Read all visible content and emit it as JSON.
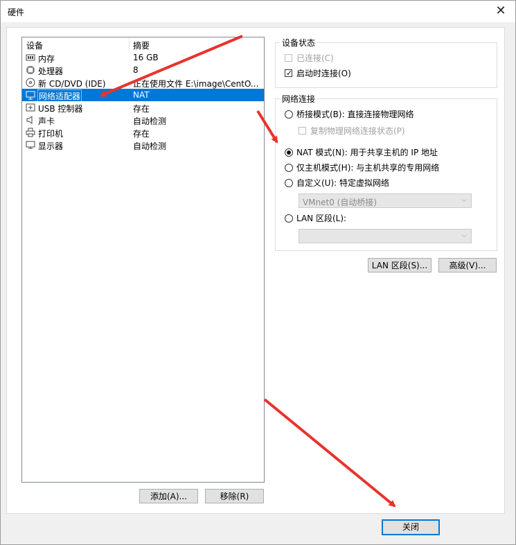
{
  "window": {
    "title": "硬件",
    "close_glyph": "✕"
  },
  "device_list": {
    "columns": [
      "设备",
      "摘要"
    ],
    "rows": [
      {
        "name": "内存",
        "summary": "16 GB",
        "icon": "memory-icon"
      },
      {
        "name": "处理器",
        "summary": "8",
        "icon": "processor-icon"
      },
      {
        "name": "新 CD/DVD (IDE)",
        "summary": "正在使用文件 E:\\image\\CentO...",
        "icon": "cd-dvd-icon"
      },
      {
        "name": "网络适配器",
        "summary": "NAT",
        "icon": "network-adapter-icon",
        "selected": true
      },
      {
        "name": "USB 控制器",
        "summary": "存在",
        "icon": "usb-icon"
      },
      {
        "name": "声卡",
        "summary": "自动检测",
        "icon": "sound-card-icon"
      },
      {
        "name": "打印机",
        "summary": "存在",
        "icon": "printer-icon"
      },
      {
        "name": "显示器",
        "summary": "自动检测",
        "icon": "display-icon"
      }
    ]
  },
  "buttons": {
    "add": "添加(A)...",
    "remove": "移除(R)",
    "lan_segment": "LAN 区段(S)...",
    "advanced": "高级(V)...",
    "close": "关闭"
  },
  "device_status": {
    "title": "设备状态",
    "connected": {
      "label": "已连接(C)",
      "checked": false,
      "enabled": false
    },
    "connect_at_power_on": {
      "label": "启动时连接(O)",
      "checked": true,
      "enabled": true
    }
  },
  "network_connection": {
    "title": "网络连接",
    "bridged": {
      "label": "桥接模式(B): 直接连接物理网络",
      "selected": false
    },
    "replicate": {
      "label": "复制物理网络连接状态(P)",
      "checked": false,
      "enabled": false
    },
    "nat": {
      "label": "NAT 模式(N): 用于共享主机的 IP 地址",
      "selected": true
    },
    "host_only": {
      "label": "仅主机模式(H): 与主机共享的专用网络",
      "selected": false
    },
    "custom": {
      "label": "自定义(U): 特定虚拟网络",
      "selected": false
    },
    "custom_value": "VMnet0 (自动桥接)",
    "lan_segment": {
      "label": "LAN 区段(L):",
      "selected": false
    },
    "lan_value": ""
  },
  "colors": {
    "selection": "#0078d7",
    "annotation_arrow": "#e8332d"
  }
}
